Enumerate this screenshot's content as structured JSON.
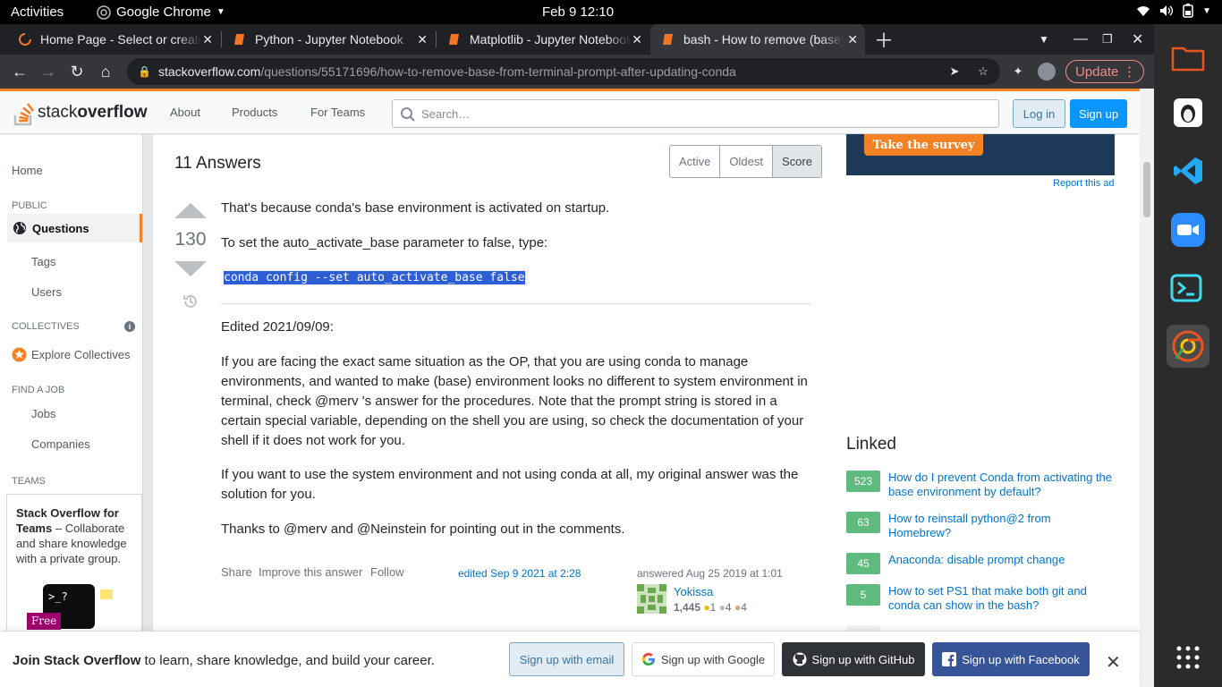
{
  "os": {
    "activities": "Activities",
    "app_name": "Google Chrome",
    "clock": "Feb 9  12:10"
  },
  "browser": {
    "tabs": [
      {
        "title": "Home Page - Select or create a notebook"
      },
      {
        "title": "Python - Jupyter Notebook"
      },
      {
        "title": "Matplotlib - Jupyter Notebook"
      },
      {
        "title": "bash - How to remove (base) from terminal prompt"
      }
    ],
    "url_host": "stackoverflow.com",
    "url_path": "/questions/55171696/how-to-remove-base-from-terminal-prompt-after-updating-conda",
    "update_label": "Update"
  },
  "so_header": {
    "logo_light": "stack",
    "logo_bold": "overflow",
    "nav": [
      "About",
      "Products",
      "For Teams"
    ],
    "search_placeholder": "Search…",
    "login": "Log in",
    "signup": "Sign up"
  },
  "leftnav": {
    "home": "Home",
    "public": "PUBLIC",
    "questions": "Questions",
    "tags": "Tags",
    "users": "Users",
    "collectives": "COLLECTIVES",
    "explore_collectives": "Explore Collectives",
    "find_job": "FIND A JOB",
    "jobs": "Jobs",
    "companies": "Companies",
    "teams": "TEAMS",
    "teams_title": "Stack Overflow for Teams",
    "teams_desc": " – Collaborate and share knowledge with a private group.",
    "free_badge": "Free"
  },
  "answers": {
    "heading": "11 Answers",
    "sort_tabs": [
      "Active",
      "Oldest",
      "Score"
    ],
    "vote_count": "130",
    "p1": "That's because conda's base environment is activated on startup.",
    "p2": "To set the auto_activate_base parameter to false, type:",
    "code": "conda config --set auto_activate_base false",
    "p3": "Edited 2021/09/09:",
    "p4": "If you are facing the exact same situation as the OP, that you are using conda to manage environments, and wanted to make (base) environment looks no different to system environment in terminal, check @merv 's answer for the procedures. Note that the prompt string is stored in a certain special variable, depending on the shell you are using, so check the documentation of your shell if it does not work for you.",
    "p5": "If you want to use the system environment and not using conda at all, my original answer was the solution for you.",
    "p6": "Thanks to @merv and @Neinstein for pointing out in the comments.",
    "menu": [
      "Share",
      "Improve this answer",
      "Follow"
    ],
    "edited": "edited Sep 9 2021 at 2:28",
    "answered": "answered Aug 25 2019 at 1:01",
    "user_name": "Yokissa",
    "user_rep": "1,445",
    "badge_gold": "1",
    "badge_silver": "4",
    "badge_bronze": "4"
  },
  "sidebar": {
    "ad_button": "Take the survey",
    "report_ad": "Report this ad",
    "linked_heading": "Linked",
    "linked": [
      {
        "score": "523",
        "title": "How do I prevent Conda from activating the base environment by default?"
      },
      {
        "score": "63",
        "title": "How to reinstall python@2 from Homebrew?"
      },
      {
        "score": "45",
        "title": "Anaconda: disable prompt change"
      },
      {
        "score": "5",
        "title": "How to set PS1 that make both git and conda can show in the bash?"
      }
    ]
  },
  "banner": {
    "bold": "Join Stack Overflow",
    "text": " to learn, share knowledge, and build your career.",
    "email": "Sign up with email",
    "google": "Sign up with Google",
    "github": "Sign up with GitHub",
    "facebook": "Sign up with Facebook"
  },
  "colors": {
    "accent": "#f48225",
    "link": "#0074cc",
    "linked_score": "#5eba7d"
  }
}
